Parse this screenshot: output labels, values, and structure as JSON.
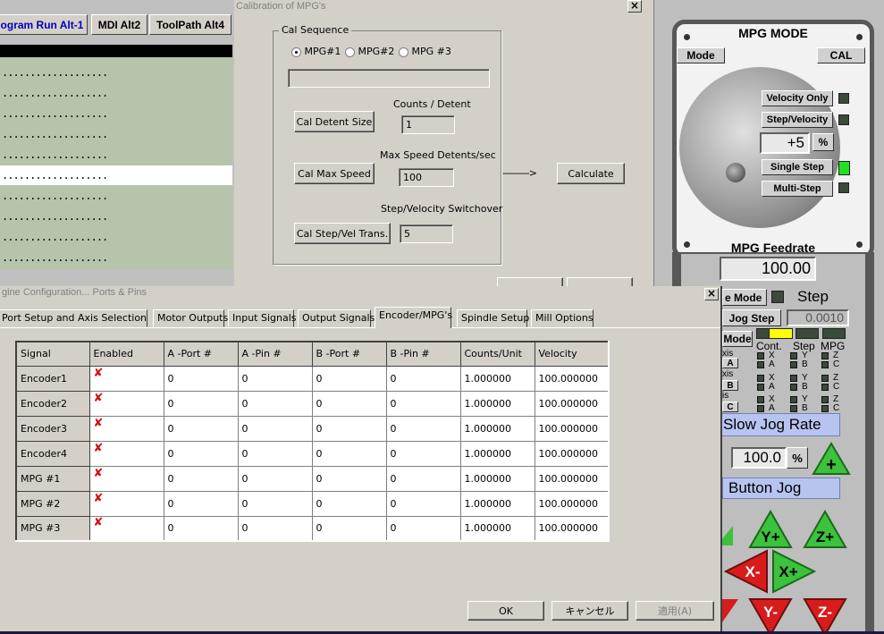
{
  "left_panel": {
    "tabs": [
      "ogram Run Alt-1",
      "MDI Alt2",
      "ToolPath Alt4"
    ],
    "gcode_lines": [
      "...................",
      "...................",
      "...................",
      "...................",
      "...................",
      "...................",
      "...................",
      "...................",
      "...................",
      "..................."
    ],
    "selected_line": 5
  },
  "cal_dialog": {
    "title": "Calibration of MPG's",
    "group_title": "Cal Sequence",
    "radios": [
      "MPG#1",
      "MPG#2",
      "MPG #3"
    ],
    "selected_radio": 0,
    "counts_label": "Counts / Detent",
    "counts_value": "1",
    "cal_detent_btn": "Cal Detent Size",
    "max_speed_label": "Max Speed Detents/sec",
    "max_speed_value": "100",
    "cal_max_speed_btn": "Cal Max Speed",
    "arrow_text": "---------->",
    "calculate_btn": "Calculate",
    "switchover_label": "Step/Velocity Switchover",
    "switchover_value": "5",
    "cal_step_btn": "Cal Step/Vel Trans."
  },
  "mpg_panel": {
    "title": "MPG MODE",
    "mode_btn": "Mode",
    "cal_btn": "CAL",
    "velocity_only": "Velocity Only",
    "step_velocity": "Step/Velocity",
    "step_value": "+5",
    "percent": "%",
    "single_step": "Single Step",
    "multi_step": "Multi-Step",
    "feedrate_label": "MPG Feedrate",
    "feedrate_value": "100.00",
    "jog_mode_btn": "e Mode",
    "step_label": "Step",
    "jog_step_btn": "Jog Step",
    "jog_step_value": "0.0010",
    "mode_btn2": "Mode",
    "cont_label": "Cont.",
    "step_col_label": "Step",
    "mpg_col_label": "MPG",
    "axis_labels": [
      "xis",
      "xis",
      "is"
    ],
    "axis_btns": [
      "A",
      "B",
      "C"
    ],
    "axis_letters": [
      [
        "X",
        "Y",
        "Z"
      ],
      [
        "A",
        "B",
        "C"
      ]
    ],
    "slow_jog_rate": "Slow Jog Rate",
    "jog_rate_value": "100.0",
    "jog_rate_unit": "%",
    "button_jog": "Button Jog",
    "jog_buttons": [
      "Y+",
      "Z+",
      "X-",
      "X+",
      "Y-",
      "Z-"
    ],
    "colors": {
      "led_green": "#22e022",
      "led_yellow": "#ffff00",
      "jog_green": "#3cc23c",
      "jog_red": "#d81c1c"
    }
  },
  "engine_dialog": {
    "title": "gine Configuration... Ports & Pins",
    "tabs": [
      "Port Setup and Axis Selection",
      "Motor Outputs",
      "Input Signals",
      "Output Signals",
      "Encoder/MPG's",
      "Spindle Setup",
      "Mill Options"
    ],
    "active_tab": 4,
    "columns": [
      "Signal",
      "Enabled",
      "A -Port #",
      "A -Pin  #",
      "B -Port #",
      "B -Pin  #",
      "Counts/Unit",
      "Velocity"
    ],
    "rows": [
      [
        "Encoder1",
        "✘",
        "0",
        "0",
        "0",
        "0",
        "1.000000",
        "100.000000"
      ],
      [
        "Encoder2",
        "✘",
        "0",
        "0",
        "0",
        "0",
        "1.000000",
        "100.000000"
      ],
      [
        "Encoder3",
        "✘",
        "0",
        "0",
        "0",
        "0",
        "1.000000",
        "100.000000"
      ],
      [
        "Encoder4",
        "✘",
        "0",
        "0",
        "0",
        "0",
        "1.000000",
        "100.000000"
      ],
      [
        "MPG #1",
        "✘",
        "0",
        "0",
        "0",
        "0",
        "1.000000",
        "100.000000"
      ],
      [
        "MPG #2",
        "✘",
        "0",
        "0",
        "0",
        "0",
        "1.000000",
        "100.000000"
      ],
      [
        "MPG #3",
        "✘",
        "0",
        "0",
        "0",
        "0",
        "1.000000",
        "100.000000"
      ]
    ],
    "ok_btn": "OK",
    "cancel_btn": "キャンセル",
    "apply_btn": "適用(A)"
  }
}
